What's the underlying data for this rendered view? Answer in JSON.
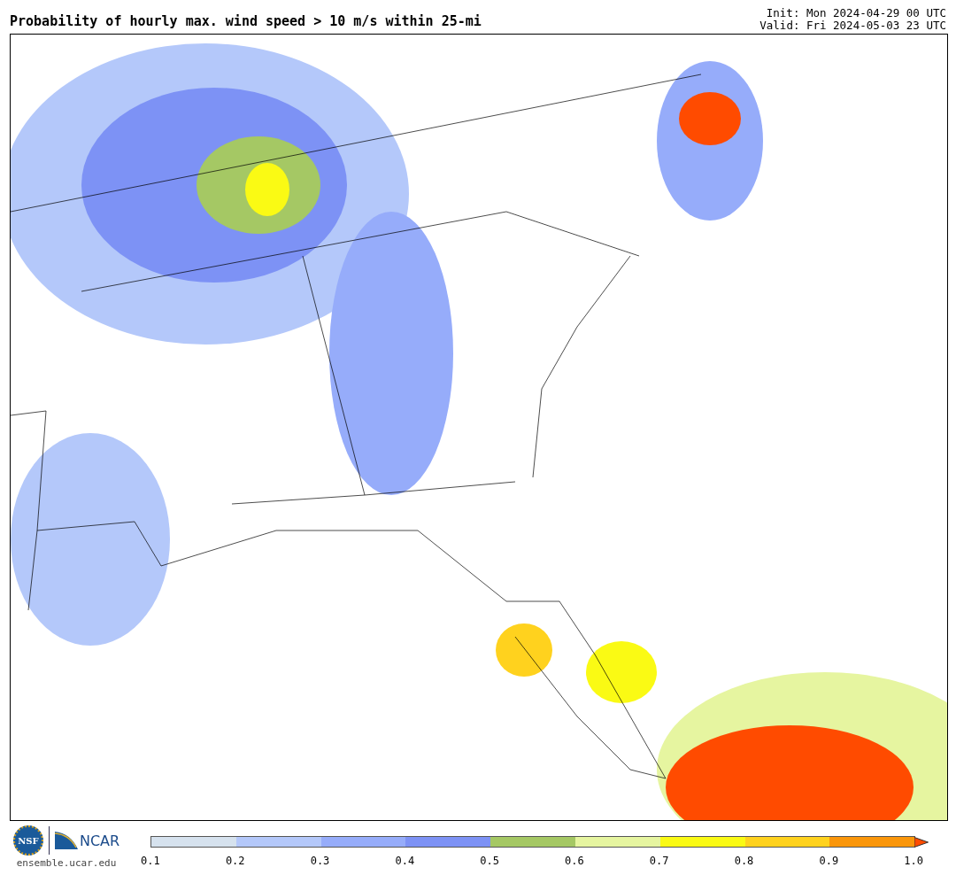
{
  "title": "Probability of hourly max. wind speed > 10 m/s within 25-mi",
  "init": "Init: Mon 2024-04-29 00 UTC",
  "valid": "Valid: Fri 2024-05-03 23 UTC",
  "logos": {
    "nsf": "NSF",
    "ncar": "NCAR",
    "site": "ensemble.ucar.edu"
  },
  "colorbar": {
    "bins": [
      {
        "color": "#d6e2ee"
      },
      {
        "color": "#b4c8fa"
      },
      {
        "color": "#96acfa"
      },
      {
        "color": "#7d92f5"
      },
      {
        "color": "#a5c864"
      },
      {
        "color": "#e6f5a0"
      },
      {
        "color": "#fafa14"
      },
      {
        "color": "#ffd21e"
      },
      {
        "color": "#fa960a"
      }
    ],
    "extend": {
      "color": "#ff4b00"
    },
    "ticks": [
      "0.1",
      "0.2",
      "0.3",
      "0.4",
      "0.5",
      "0.6",
      "0.7",
      "0.8",
      "0.9",
      "1.0"
    ]
  }
}
